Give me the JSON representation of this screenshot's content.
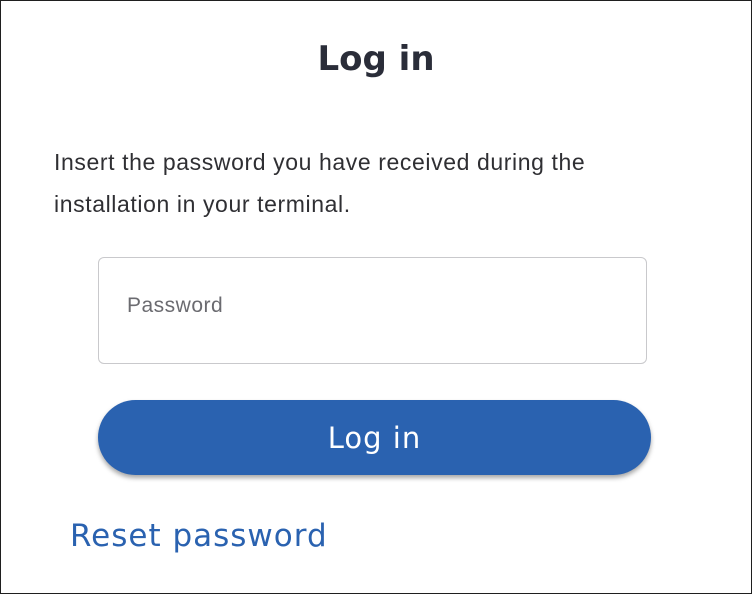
{
  "login": {
    "title": "Log in",
    "description": "Insert the password you have received during the installation in your terminal.",
    "password": {
      "placeholder": "Password",
      "value": ""
    },
    "submit_label": "Log in",
    "reset_link_label": "Reset password"
  },
  "colors": {
    "primary": "#2a62b0",
    "title_text": "#2a2d39",
    "border": "#c9c9cc"
  }
}
